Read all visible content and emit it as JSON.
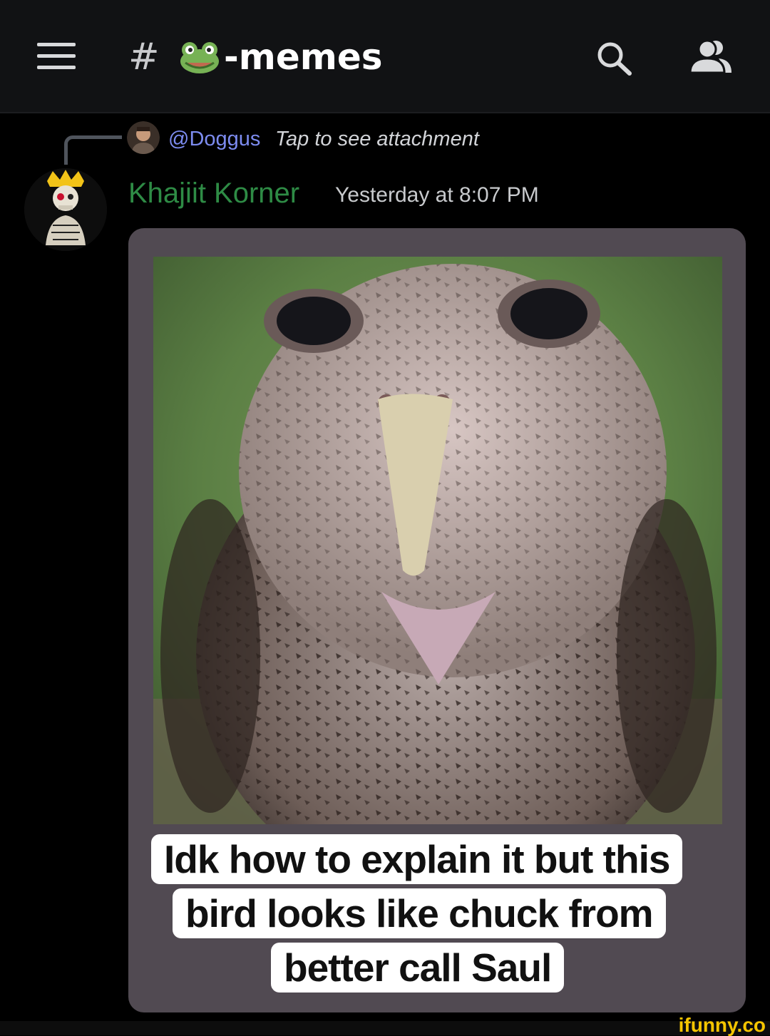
{
  "header": {
    "channel_prefix": "#",
    "channel_name": "-memes",
    "channel_emoji": "frog-icon",
    "icons": [
      "hamburger-menu-icon",
      "search-icon",
      "members-icon"
    ]
  },
  "reply": {
    "mention": "@Doggus",
    "text": "Tap to see attachment"
  },
  "message": {
    "username": "Khajiit Korner",
    "timestamp": "Yesterday at 8:07 PM",
    "username_color": "#2e8b45"
  },
  "attachment": {
    "caption_lines": [
      "Idk how to explain it but this",
      "bird looks like chuck from",
      "better call Saul"
    ]
  },
  "watermark": "ifunny.co"
}
